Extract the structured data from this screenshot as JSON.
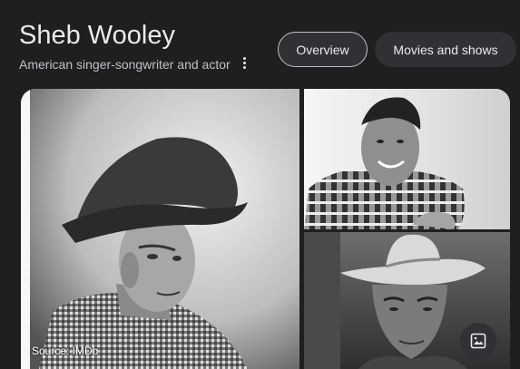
{
  "header": {
    "title": "Sheb Wooley",
    "subtitle": "American singer-songwriter and actor",
    "more_icon": "more-vert-icon"
  },
  "tabs": [
    {
      "label": "Overview",
      "selected": true
    },
    {
      "label": "Movies and shows",
      "selected": false
    }
  ],
  "gallery": {
    "source_text": "Source: IMDb",
    "images_icon": "image-icon"
  },
  "colors": {
    "background": "#1f1f1f",
    "text_primary": "#e8eaed",
    "text_secondary": "#bdc1c6",
    "chip_bg": "#303134"
  }
}
